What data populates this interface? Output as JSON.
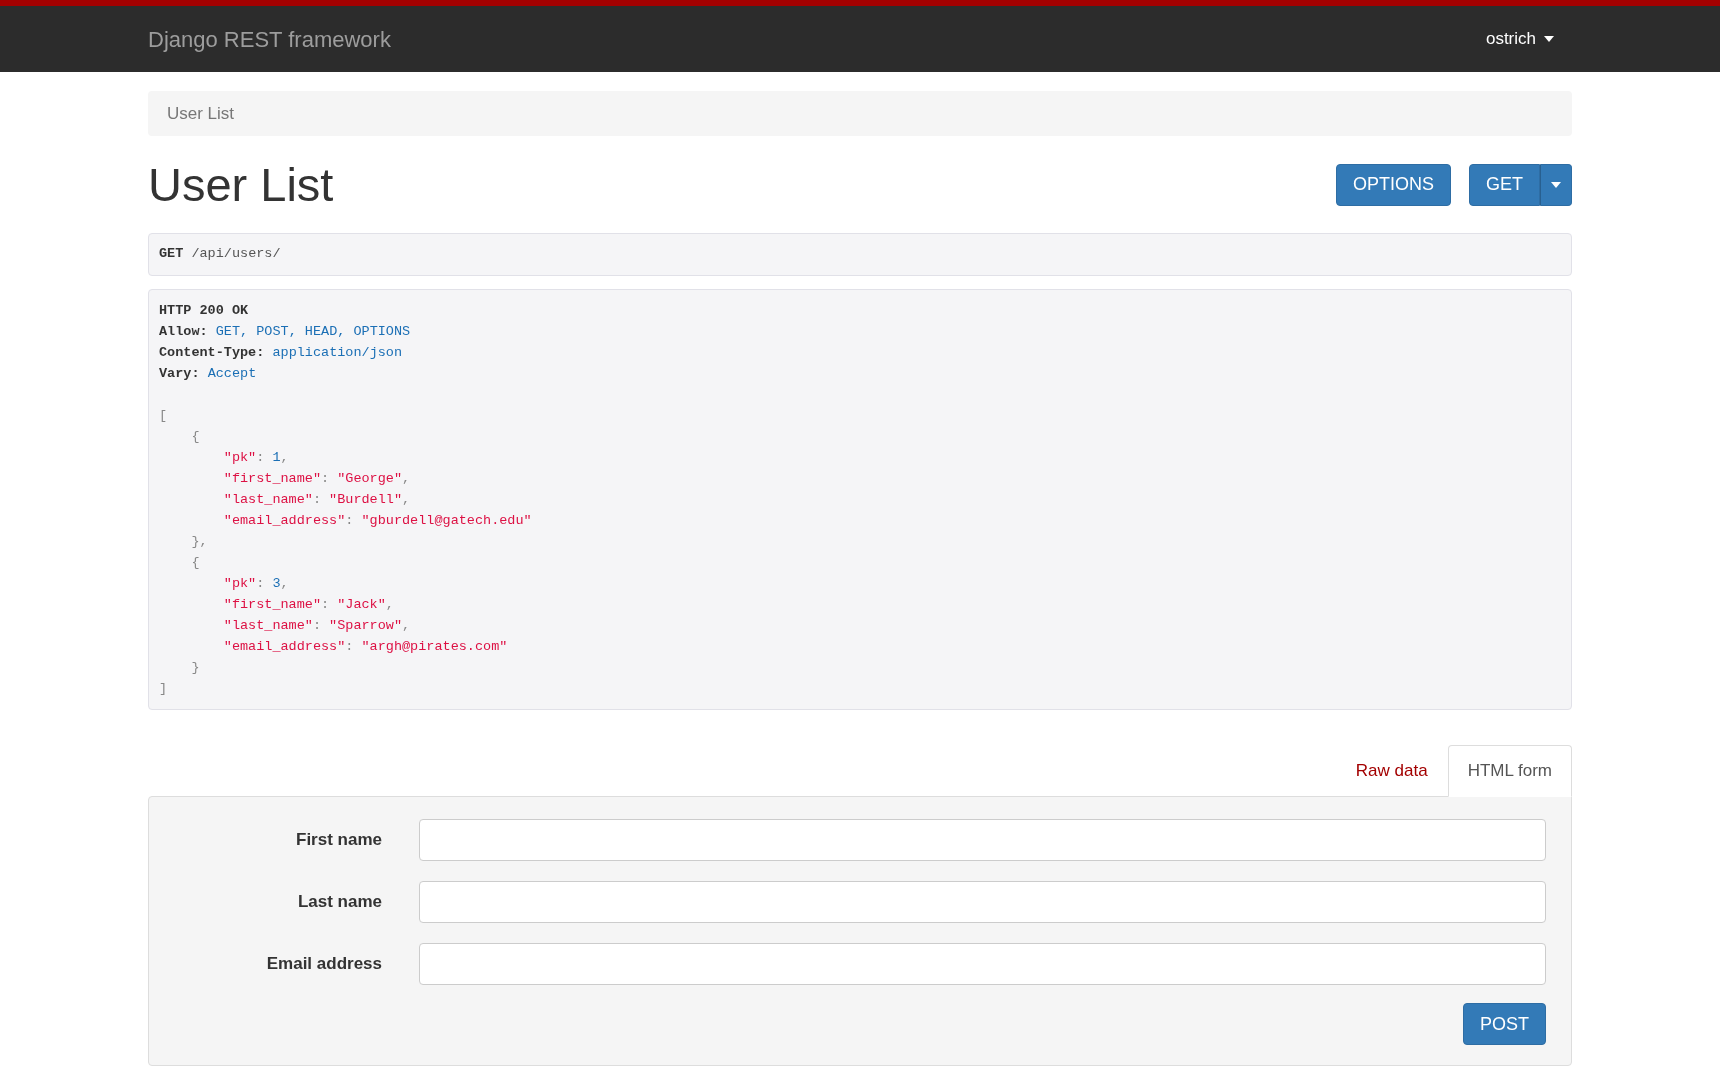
{
  "navbar": {
    "brand": "Django REST framework",
    "user_menu": "ostrich"
  },
  "breadcrumb": [
    {
      "label": "User List",
      "selected": true
    }
  ],
  "page_title": "User List",
  "actions": {
    "options_button": "OPTIONS",
    "get_button": "GET"
  },
  "request": {
    "method": "GET",
    "path": "/api/users/"
  },
  "response": {
    "status": "HTTP 200 OK",
    "headers": [
      {
        "name": "Allow:",
        "value": "GET, POST, HEAD, OPTIONS"
      },
      {
        "name": "Content-Type:",
        "value": "application/json"
      },
      {
        "name": "Vary:",
        "value": "Accept"
      }
    ],
    "body": [
      {
        "tokens": [
          {
            "kind": "punct",
            "text": "["
          }
        ],
        "children": [
          {
            "tokens": [
              {
                "kind": "punct",
                "text": "{"
              }
            ],
            "children": [
              {
                "tokens": [
                  {
                    "kind": "key",
                    "text": "\"pk\""
                  },
                  {
                    "kind": "punct",
                    "text": ": "
                  },
                  {
                    "kind": "number",
                    "text": "1"
                  },
                  {
                    "kind": "punct",
                    "text": ","
                  }
                ]
              },
              {
                "tokens": [
                  {
                    "kind": "key",
                    "text": "\"first_name\""
                  },
                  {
                    "kind": "punct",
                    "text": ": "
                  },
                  {
                    "kind": "string",
                    "text": "\"George\""
                  },
                  {
                    "kind": "punct",
                    "text": ","
                  }
                ]
              },
              {
                "tokens": [
                  {
                    "kind": "key",
                    "text": "\"last_name\""
                  },
                  {
                    "kind": "punct",
                    "text": ": "
                  },
                  {
                    "kind": "string",
                    "text": "\"Burdell\""
                  },
                  {
                    "kind": "punct",
                    "text": ","
                  }
                ]
              },
              {
                "tokens": [
                  {
                    "kind": "key",
                    "text": "\"email_address\""
                  },
                  {
                    "kind": "punct",
                    "text": ": "
                  },
                  {
                    "kind": "string",
                    "text": "\"gburdell@gatech.edu\""
                  }
                ]
              }
            ]
          },
          {
            "tokens": [
              {
                "kind": "punct",
                "text": "},"
              }
            ]
          },
          {
            "tokens": [
              {
                "kind": "punct",
                "text": "{"
              }
            ],
            "children": [
              {
                "tokens": [
                  {
                    "kind": "key",
                    "text": "\"pk\""
                  },
                  {
                    "kind": "punct",
                    "text": ": "
                  },
                  {
                    "kind": "number",
                    "text": "3"
                  },
                  {
                    "kind": "punct",
                    "text": ","
                  }
                ]
              },
              {
                "tokens": [
                  {
                    "kind": "key",
                    "text": "\"first_name\""
                  },
                  {
                    "kind": "punct",
                    "text": ": "
                  },
                  {
                    "kind": "string",
                    "text": "\"Jack\""
                  },
                  {
                    "kind": "punct",
                    "text": ","
                  }
                ]
              },
              {
                "tokens": [
                  {
                    "kind": "key",
                    "text": "\"last_name\""
                  },
                  {
                    "kind": "punct",
                    "text": ": "
                  },
                  {
                    "kind": "string",
                    "text": "\"Sparrow\""
                  },
                  {
                    "kind": "punct",
                    "text": ","
                  }
                ]
              },
              {
                "tokens": [
                  {
                    "kind": "key",
                    "text": "\"email_address\""
                  },
                  {
                    "kind": "punct",
                    "text": ": "
                  },
                  {
                    "kind": "string",
                    "text": "\"argh@pirates.com\""
                  }
                ]
              }
            ]
          },
          {
            "tokens": [
              {
                "kind": "punct",
                "text": "}"
              }
            ]
          }
        ]
      },
      {
        "tokens": [
          {
            "kind": "punct",
            "text": "]"
          }
        ]
      }
    ]
  },
  "form_tabs": [
    {
      "label": "Raw data",
      "selected": false
    },
    {
      "label": "HTML form",
      "selected": true
    }
  ],
  "form": {
    "fields": [
      {
        "label": "First name"
      },
      {
        "label": "Last name"
      },
      {
        "label": "Email address"
      }
    ],
    "submit": "POST"
  }
}
